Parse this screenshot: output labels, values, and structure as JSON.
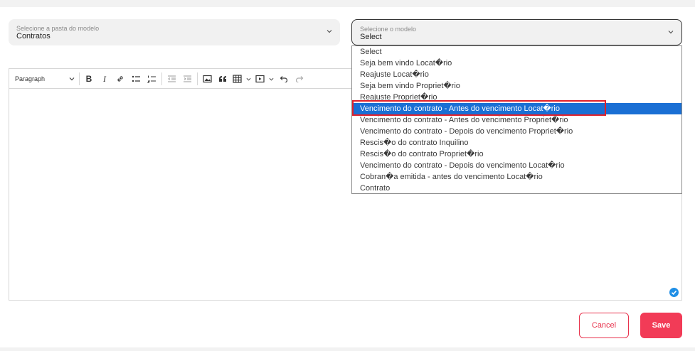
{
  "folder_select": {
    "label": "Selecione a pasta do modelo",
    "value": "Contratos"
  },
  "model_select": {
    "label": "Selecione o modelo",
    "value": "Select"
  },
  "toolbar": {
    "paragraph_label": "Paragraph",
    "bold_label": "B",
    "italic_label": "I"
  },
  "dropdown": {
    "options": [
      "Select",
      "Seja bem vindo Locat�rio",
      "Reajuste Locat�rio",
      "Seja bem vindo Propriet�rio",
      "Reajuste Propriet�rio",
      "Vencimento do contrato - Antes do vencimento Locat�rio",
      "Vencimento do contrato - Antes do vencimento Propriet�rio",
      "Vencimento do contrato - Depois do vencimento Propriet�rio",
      "Rescis�o do contrato Inquilino",
      "Rescis�o do contrato Propriet�rio",
      "Vencimento do contrato - Depois do vencimento Locat�rio",
      "Cobran�a emitida - antes do vencimento Locat�rio",
      "Contrato"
    ],
    "selected_index": 5
  },
  "buttons": {
    "cancel_label": "Cancel",
    "save_label": "Save"
  },
  "colors": {
    "accent": "#f23b57",
    "selected_option": "#1a6fd4",
    "highlight_box": "#e0202a"
  }
}
